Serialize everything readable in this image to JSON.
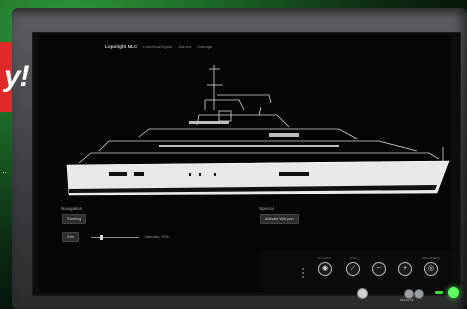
{
  "app": {
    "title": "Lopolight NLC",
    "tabs": [
      "Individual lights",
      "Alarms",
      "Manage"
    ]
  },
  "navigation": {
    "label": "Navigation",
    "mode_button": "Running",
    "dim_button": "Dim",
    "intensity_label": "Intensity: 20%",
    "intensity_fraction": 0.2
  },
  "special": {
    "label": "Special",
    "button": "Activate Wet pan"
  },
  "controls": {
    "labels": [
      "ACTIVATE",
      "MAIN",
      "",
      "",
      "BRIGHTNESS"
    ],
    "buttons": [
      {
        "name": "activate-control",
        "glyph": "◉"
      },
      {
        "name": "main-control",
        "glyph": "⟋"
      },
      {
        "name": "minus-control",
        "glyph": "−"
      },
      {
        "name": "plus-control",
        "glyph": "+"
      },
      {
        "name": "brightness-control",
        "glyph": "◎"
      }
    ]
  },
  "hardware": {
    "bottom_label": "RESOLUTE"
  },
  "overlay": {
    "banner_text": "y!",
    "ellipsis": ".."
  },
  "colors": {
    "banner": "#e02a2a",
    "power_led": "#3ee23e"
  }
}
